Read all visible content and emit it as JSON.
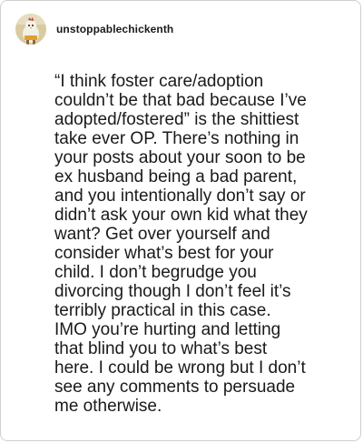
{
  "post": {
    "username": "unstoppablechickenth",
    "avatar_icon": "chicken-avatar-icon",
    "body": "“I think foster care/adoption\ncouldn’t be that bad because I’ve\nadopted/fostered” is the shittiest\ntake ever OP. There’s nothing in\nyour posts about your soon to be\nex husband being a bad parent,\nand you intentionally don’t say or\ndidn’t ask your own kid what they\nwant? Get over yourself and\nconsider what’s best for your\nchild. I don’t begrudge you\ndivorcing though I don’t feel it’s\nterribly practical in this case.\nIMO you’re hurting and letting\nthat blind you to what’s best\nhere. I could be wrong but I don’t\nsee any comments to persuade\nme otherwise."
  },
  "colors": {
    "background": "#ffffff",
    "border": "#cfcfcf",
    "text": "#1a1a1a",
    "avatar_bg": "#d9cba0",
    "avatar_accent": "#e0a030"
  }
}
